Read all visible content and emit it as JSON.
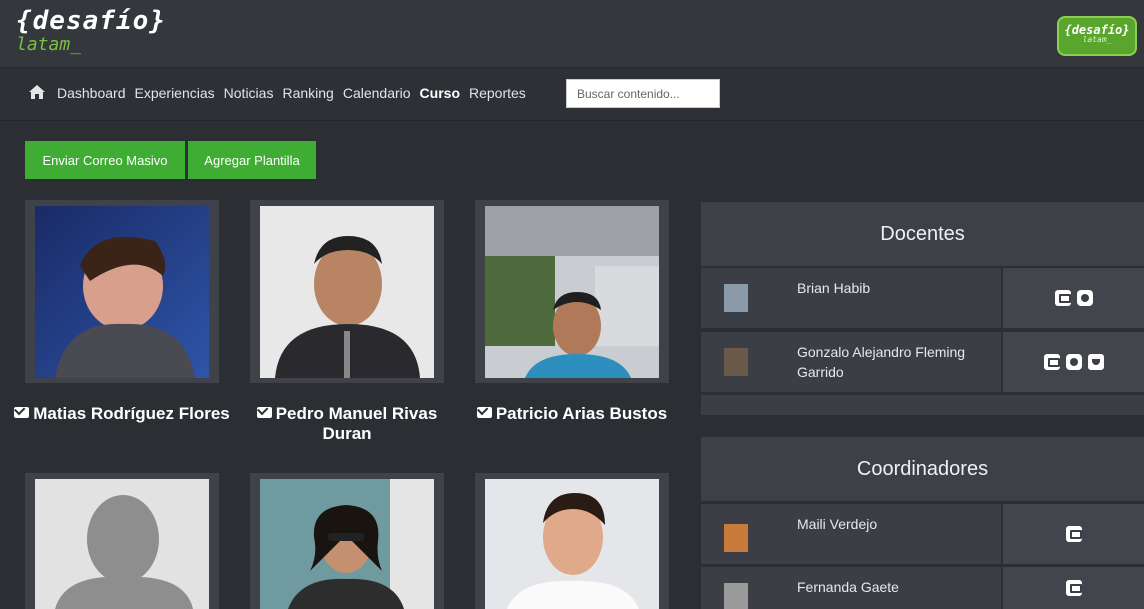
{
  "header": {
    "logo_top": "{desafío}",
    "logo_bottom": "latam_",
    "badge_top": "{desafío}",
    "badge_bottom": "latam_"
  },
  "nav": {
    "items": [
      "Dashboard",
      "Experiencias",
      "Noticias",
      "Ranking",
      "Calendario",
      "Curso",
      "Reportes"
    ],
    "active": "Curso",
    "search_placeholder": "Buscar contenido..."
  },
  "actions": {
    "mass_mail": "Enviar Correo Masivo",
    "add_template": "Agregar Plantilla"
  },
  "students": [
    {
      "name": "Matias Rodríguez Flores"
    },
    {
      "name": "Pedro Manuel Rivas Duran"
    },
    {
      "name": "Patricio Arias Bustos"
    },
    {
      "name": ""
    },
    {
      "name": ""
    },
    {
      "name": ""
    }
  ],
  "docentes": {
    "title": "Docentes",
    "people": [
      {
        "name": "Brian Habib",
        "icons": [
          "mail-icon",
          "github-icon"
        ]
      },
      {
        "name": "Gonzalo Alejandro Fleming Garrido",
        "icons": [
          "mail-icon",
          "github-icon",
          "twitter-icon"
        ]
      }
    ]
  },
  "coordinadores": {
    "title": "Coordinadores",
    "people": [
      {
        "name": "Maili Verdejo",
        "icons": [
          "mail-icon"
        ]
      },
      {
        "name": "Fernanda Gaete",
        "icons": [
          "mail-icon"
        ]
      }
    ]
  },
  "colors": {
    "background": "#2b2e33",
    "accent_green": "#3fad34",
    "card": "#3f4249"
  }
}
